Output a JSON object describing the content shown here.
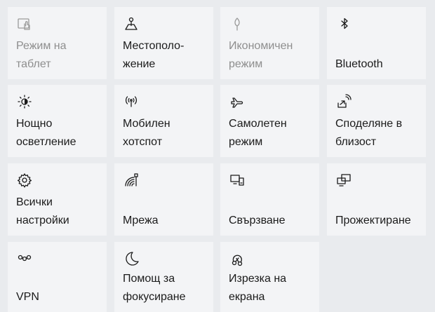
{
  "tiles": {
    "tablet_mode": {
      "label": "Режим на\nтаблет",
      "enabled": false
    },
    "location": {
      "label": "Местополо-\nжение",
      "enabled": true
    },
    "battery_saver": {
      "label": "Икономичен\nрежим",
      "enabled": false
    },
    "bluetooth": {
      "label": "Bluetooth",
      "enabled": true
    },
    "night_light": {
      "label": "Нощно\nосветление",
      "enabled": true
    },
    "mobile_hotspot": {
      "label": "Мобилен\nхотспот",
      "enabled": true
    },
    "airplane_mode": {
      "label": "Самолетен\nрежим",
      "enabled": true
    },
    "nearby_sharing": {
      "label": "Споделяне в\nблизост",
      "enabled": true
    },
    "all_settings": {
      "label": "Всички\nнастройки",
      "enabled": true
    },
    "network": {
      "label": "Мрежа",
      "enabled": true
    },
    "connect": {
      "label": "Свързване",
      "enabled": true
    },
    "project": {
      "label": "Прожектиране",
      "enabled": true
    },
    "vpn": {
      "label": "VPN",
      "enabled": true
    },
    "focus_assist": {
      "label": "Помощ за\nфокусиране",
      "enabled": true
    },
    "snip": {
      "label": "Изрезка на\nекрана",
      "enabled": true
    }
  },
  "colors": {
    "background": "#e9ebee",
    "tile": "#f3f4f6",
    "text": "#1b1b1b",
    "disabled_text": "#8e8e8e"
  }
}
